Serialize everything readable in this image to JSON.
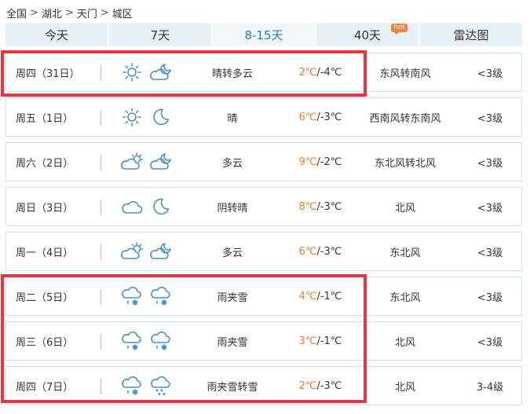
{
  "breadcrumb": [
    "全国",
    "湖北",
    "天门",
    "城区"
  ],
  "tabs": [
    {
      "label": "今天",
      "active": false,
      "badge": ""
    },
    {
      "label": "7天",
      "active": false,
      "badge": ""
    },
    {
      "label": "8-15天",
      "active": true,
      "badge": ""
    },
    {
      "label": "40天",
      "active": false,
      "badge": "hot"
    },
    {
      "label": "雷达图",
      "active": false,
      "badge": ""
    }
  ],
  "days": [
    {
      "date": "周四（31日）",
      "icon_day": "sun-icon",
      "icon_night": "night-partly-cloudy-icon",
      "desc": "晴转多云",
      "high": "2℃",
      "low": "-4℃",
      "wind": "东风转南风",
      "level": "<3级"
    },
    {
      "date": "周五（1日）",
      "icon_day": "sun-icon",
      "icon_night": "moon-icon",
      "desc": "晴",
      "high": "6℃",
      "low": "-3℃",
      "wind": "西南风转东南风",
      "level": "<3级"
    },
    {
      "date": "周六（2日）",
      "icon_day": "partly-cloudy-icon",
      "icon_night": "night-partly-cloudy-icon",
      "desc": "多云",
      "high": "9℃",
      "low": "-2℃",
      "wind": "东北风转北风",
      "level": "<3级"
    },
    {
      "date": "周日（3日）",
      "icon_day": "cloud-icon",
      "icon_night": "moon-icon",
      "desc": "阴转晴",
      "high": "8℃",
      "low": "-3℃",
      "wind": "北风",
      "level": "<3级"
    },
    {
      "date": "周一（4日）",
      "icon_day": "partly-cloudy-icon",
      "icon_night": "night-partly-cloudy-icon",
      "desc": "多云",
      "high": "6℃",
      "low": "-3℃",
      "wind": "东北风",
      "level": "<3级"
    },
    {
      "date": "周二（5日）",
      "icon_day": "sleet-icon",
      "icon_night": "sleet-icon",
      "desc": "雨夹雪",
      "high": "4℃",
      "low": "-1℃",
      "wind": "东北风",
      "level": "<3级"
    },
    {
      "date": "周三（6日）",
      "icon_day": "sleet-icon",
      "icon_night": "sleet-icon",
      "desc": "雨夹雪",
      "high": "3℃",
      "low": "-1℃",
      "wind": "北风",
      "level": "<3级"
    },
    {
      "date": "周四（7日）",
      "icon_day": "sleet-icon",
      "icon_night": "snow-icon",
      "desc": "雨夹雪转雪",
      "high": "2℃",
      "low": "-3℃",
      "wind": "北风",
      "level": "3-4级"
    }
  ],
  "colors": {
    "accent": "#2a7ac2",
    "high_temp": "#f07a28",
    "highlight": "#ee3340",
    "tab_bg": "#e8f0f8",
    "row_border": "#cfe0ef"
  }
}
